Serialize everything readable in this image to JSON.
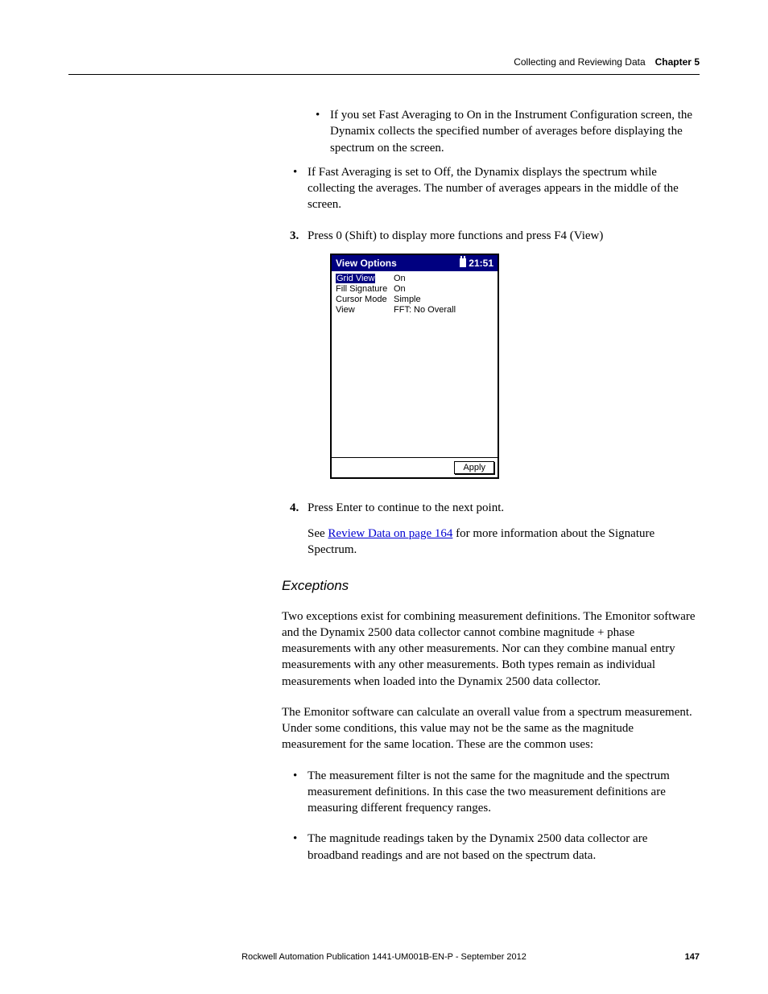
{
  "header": {
    "section": "Collecting and Reviewing Data",
    "chapter": "Chapter 5"
  },
  "body": {
    "sub_bullet": "If you set Fast Averaging to On in the Instrument Configuration screen, the Dynamix collects the specified number of averages before displaying the spectrum on the screen.",
    "main_bullet": "If Fast Averaging is set to Off, the Dynamix displays the spectrum while collecting the averages. The number of averages appears in the middle of the screen.",
    "step3_num": "3.",
    "step3": "Press 0 (Shift) to display more functions and press F4 (View)",
    "step4_num": "4.",
    "step4": "Press Enter to continue to the next point.",
    "see_prefix": "See ",
    "see_link": "Review Data on page 164",
    "see_suffix": " for more information about the Signature Spectrum.",
    "h3": "Exceptions",
    "p1": "Two exceptions exist for combining measurement definitions. The Emonitor software and the Dynamix 2500 data collector cannot combine magnitude + phase measurements with any other measurements. Nor can they combine manual entry measurements with any other measurements. Both types remain as individual measurements when loaded into the Dynamix 2500 data collector.",
    "p2": "The Emonitor software can calculate an overall value from a spectrum measurement. Under some conditions, this value may not be the same as the magnitude measurement for the same location. These are the common uses:",
    "b1": "The measurement filter is not the same for the magnitude and the spectrum measurement definitions. In this case the two measurement definitions are measuring different frequency ranges.",
    "b2": "The magnitude readings taken by the Dynamix 2500 data collector are broadband readings and are not based on the spectrum data."
  },
  "device": {
    "title": "View Options",
    "time": "21:51",
    "rows": [
      {
        "label": "Grid View",
        "value": "On",
        "selected": true
      },
      {
        "label": "Fill Signature",
        "value": "On",
        "selected": false
      },
      {
        "label": "Cursor Mode",
        "value": "Simple",
        "selected": false
      },
      {
        "label": "View",
        "value": "FFT: No Overall",
        "selected": false
      }
    ],
    "apply": "Apply"
  },
  "footer": {
    "publication": "Rockwell Automation Publication 1441-UM001B-EN-P - September 2012",
    "page": "147"
  }
}
